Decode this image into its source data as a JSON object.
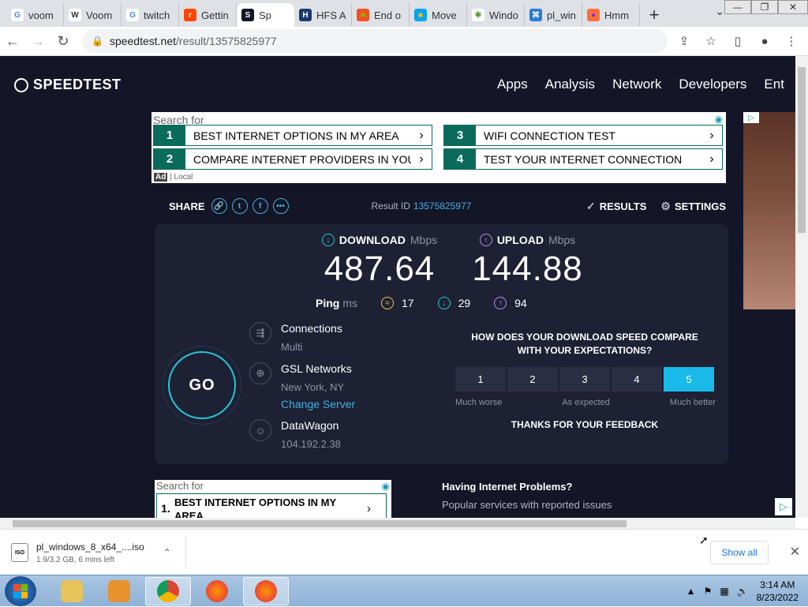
{
  "browser": {
    "tabs": [
      {
        "title": "voom",
        "fav": "G",
        "color": "#ffffff",
        "fg": "#4285f4"
      },
      {
        "title": "Voom",
        "fav": "W",
        "color": "#ffffff",
        "fg": "#333333"
      },
      {
        "title": "twitch",
        "fav": "G",
        "color": "#ffffff",
        "fg": "#4285f4"
      },
      {
        "title": "Gettin",
        "fav": "r",
        "color": "#ff4500",
        "fg": "#ffffff"
      },
      {
        "title": "Sp",
        "fav": "S",
        "color": "#141526",
        "fg": "#ffffff"
      },
      {
        "title": "HFS A",
        "fav": "H",
        "color": "#1a3a6e",
        "fg": "#ffffff"
      },
      {
        "title": "End o",
        "fav": "■",
        "color": "#f25022",
        "fg": "#7fba00"
      },
      {
        "title": "Move",
        "fav": "■",
        "color": "#00a4ef",
        "fg": "#ffb900"
      },
      {
        "title": "Windo",
        "fav": "✱",
        "color": "#ffffff",
        "fg": "#5d9c3a"
      },
      {
        "title": "pl_win",
        "fav": "⌘",
        "color": "#2b7cd3",
        "fg": "#ffffff"
      },
      {
        "title": "Hmm",
        "fav": "●",
        "color": "#ff7139",
        "fg": "#7b2bd1"
      }
    ],
    "active_tab": 4,
    "new_tab": "+",
    "url_host": "speedtest.net",
    "url_path": "/result/13575825977"
  },
  "site": {
    "logo": "SPEEDTEST",
    "nav": [
      "Apps",
      "Analysis",
      "Network",
      "Developers",
      "Ent"
    ]
  },
  "ad_top": {
    "search_for": "Search for",
    "items": [
      {
        "num": "1",
        "text": "BEST INTERNET OPTIONS IN MY AREA"
      },
      {
        "num": "2",
        "text": "COMPARE INTERNET PROVIDERS IN YOUR"
      },
      {
        "num": "3",
        "text": "WIFI CONNECTION TEST"
      },
      {
        "num": "4",
        "text": "TEST YOUR INTERNET CONNECTION"
      }
    ],
    "ad_label": "Ad",
    "local": "| Local"
  },
  "result": {
    "share_label": "SHARE",
    "result_id_label": "Result ID",
    "result_id": "13575825977",
    "results_btn": "RESULTS",
    "settings_btn": "SETTINGS",
    "download_label": "DOWNLOAD",
    "upload_label": "UPLOAD",
    "unit_mbps": "Mbps",
    "download_value": "487.64",
    "upload_value": "144.88",
    "ping_label": "Ping",
    "ping_unit": "ms",
    "ping_idle": "17",
    "ping_down": "29",
    "ping_up": "94",
    "go_label": "GO",
    "connections_label": "Connections",
    "connections_value": "Multi",
    "server_name": "GSL Networks",
    "server_location": "New York, NY",
    "change_server": "Change Server",
    "isp": "DataWagon",
    "ip": "104.192.2.38",
    "survey_question_1": "HOW DOES YOUR DOWNLOAD SPEED COMPARE",
    "survey_question_2": "WITH YOUR EXPECTATIONS?",
    "rating_options": [
      "1",
      "2",
      "3",
      "4",
      "5"
    ],
    "selected_rating": "5",
    "rating_low": "Much worse",
    "rating_mid": "As expected",
    "rating_high": "Much better",
    "thanks": "THANKS FOR YOUR FEEDBACK"
  },
  "ad_bottom": {
    "search_for": "Search for",
    "num": "1.",
    "text": "BEST INTERNET OPTIONS IN MY AREA"
  },
  "problems": {
    "heading": "Having Internet Problems?",
    "sub": "Popular services with reported issues"
  },
  "download": {
    "file_name": "pl_windows_8_x64_....iso",
    "status": "1.9/3.2 GB, 6 mins left",
    "show_all": "Show all"
  },
  "taskbar": {
    "time": "3:14 AM",
    "date": "8/23/2022"
  },
  "colors": {
    "page_bg": "#141526",
    "panel_bg": "#1d2133",
    "accent": "#3fb1e5",
    "go_ring": "#26c6da",
    "selected_rating": "#19b9ea",
    "download_icon": "#26c6da",
    "upload_icon": "#b48cf2",
    "ping_icon": "#f5c84c"
  }
}
